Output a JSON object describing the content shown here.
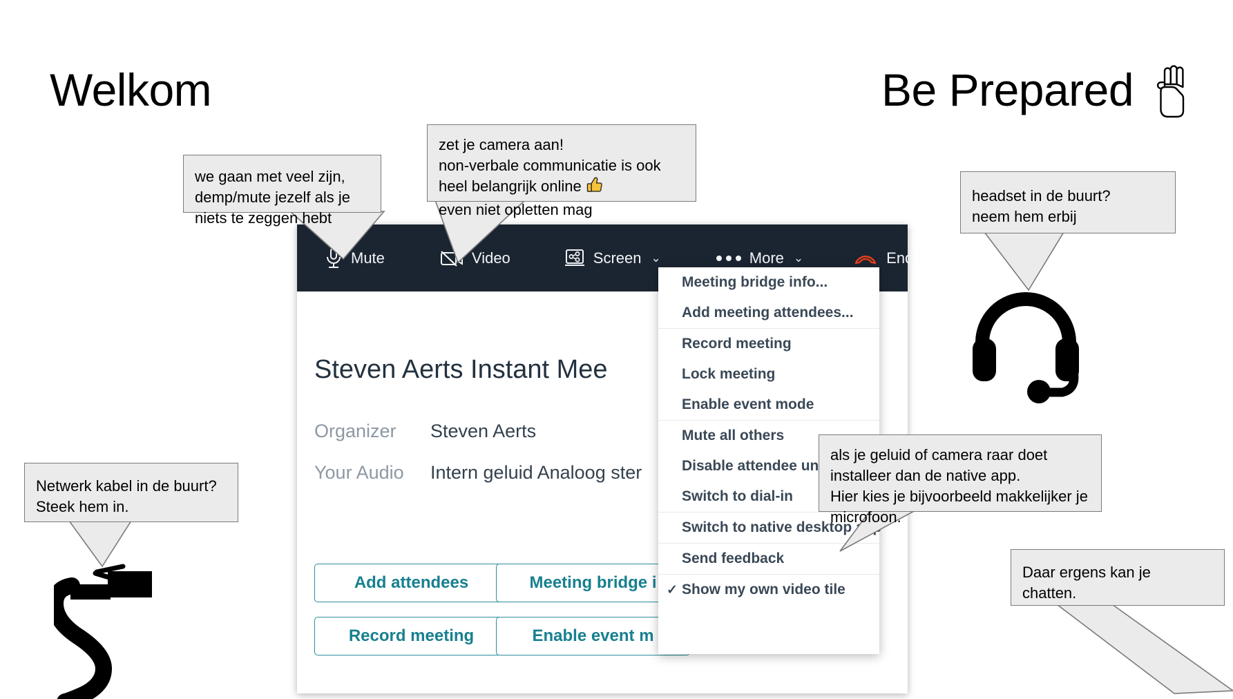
{
  "slide": {
    "title_left": "Welkom",
    "title_right": "Be Prepared",
    "salute_icon": "scout-salute-hand-icon"
  },
  "meeting_window": {
    "toolbar": {
      "background": "#1b2531",
      "items": [
        {
          "id": "mute",
          "label": "Mute",
          "icon": "microphone-icon",
          "chevron": false
        },
        {
          "id": "video",
          "label": "Video",
          "icon": "video-off-icon",
          "chevron": false
        },
        {
          "id": "screen",
          "label": "Screen",
          "icon": "screen-share-icon",
          "chevron": true
        },
        {
          "id": "more",
          "label": "More",
          "icon": "ellipsis-icon",
          "chevron": true
        },
        {
          "id": "end",
          "label": "End",
          "icon": "end-call-icon",
          "chevron": false,
          "color": "#e8401c"
        }
      ],
      "chevron_glyph": "⌄"
    },
    "meeting_title": "Steven Aerts Instant Mee",
    "details": [
      {
        "label": "Organizer",
        "value": "Steven Aerts"
      },
      {
        "label": "Your Audio",
        "value": "Intern geluid Analoog ster"
      }
    ],
    "accent_color": "#17808f",
    "buttons": [
      {
        "id": "add-attendees",
        "label": "Add attendees"
      },
      {
        "id": "bridge-info",
        "label": "Meeting bridge i"
      },
      {
        "id": "record",
        "label": "Record meeting"
      },
      {
        "id": "event-mode",
        "label": "Enable event m"
      }
    ]
  },
  "more_menu": {
    "groups": [
      {
        "items": [
          {
            "label": "Meeting bridge info...",
            "checked": false
          },
          {
            "label": "Add meeting attendees...",
            "checked": false
          }
        ]
      },
      {
        "items": [
          {
            "label": "Record meeting",
            "checked": false
          },
          {
            "label": "Lock meeting",
            "checked": false
          },
          {
            "label": "Enable event mode",
            "checked": false
          }
        ]
      },
      {
        "items": [
          {
            "label": "Mute all others",
            "checked": false
          },
          {
            "label": "Disable attendee unm",
            "checked": false
          },
          {
            "label": "Switch to dial-in",
            "checked": false
          }
        ]
      },
      {
        "items": [
          {
            "label": "Switch to native desktop app",
            "checked": false
          }
        ]
      },
      {
        "items": [
          {
            "label": "Send feedback",
            "checked": false
          }
        ]
      },
      {
        "items": [
          {
            "label": "Show my own video tile",
            "checked": true
          }
        ]
      }
    ],
    "check_glyph": "✓"
  },
  "callouts": {
    "mute": {
      "lines": [
        "we gaan met veel zijn,",
        "demp/mute jezelf als je",
        "niets te zeggen hebt"
      ]
    },
    "camera": {
      "lines": [
        "zet je camera aan!",
        "non-verbale communicatie is ook",
        "heel belangrijk online",
        "even niet opletten mag"
      ],
      "emoji": "👍"
    },
    "headset": {
      "lines": [
        "headset in de buurt?",
        "neem hem erbij"
      ]
    },
    "native_app": {
      "lines": [
        "als je geluid of camera raar doet",
        "installeer dan de native app.",
        "Hier kies je bijvoorbeeld makkelijker je",
        "microfoon."
      ]
    },
    "chat": {
      "lines": [
        "Daar ergens kan je",
        "chatten."
      ]
    },
    "cable": {
      "lines": [
        "Netwerk kabel in de buurt?",
        "Steek hem in."
      ]
    }
  },
  "illustrations": {
    "cable": "ethernet-cable-icon",
    "headset": "headset-icon"
  }
}
